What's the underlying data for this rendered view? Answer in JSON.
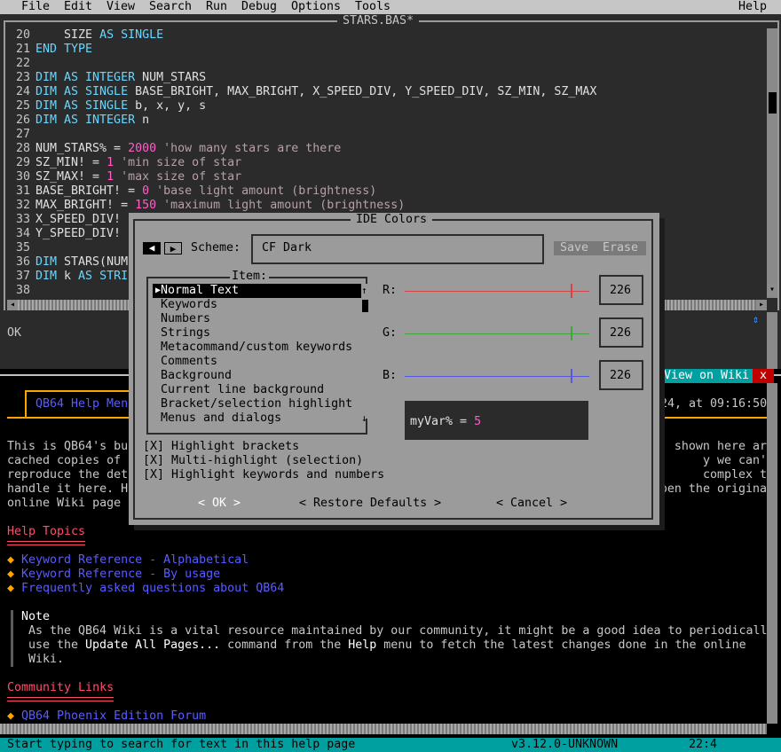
{
  "menubar": {
    "items": [
      "File",
      "Edit",
      "View",
      "Search",
      "Run",
      "Debug",
      "Options",
      "Tools"
    ],
    "help": "Help"
  },
  "editor": {
    "title": "STARS.BAS*",
    "lines": [
      {
        "n": "20",
        "code": [
          {
            "t": "    SIZE ",
            "c": ""
          },
          {
            "t": "AS SINGLE",
            "c": "kw"
          }
        ]
      },
      {
        "n": "21",
        "code": [
          {
            "t": "END TYPE",
            "c": "kw"
          }
        ]
      },
      {
        "n": "22",
        "code": []
      },
      {
        "n": "23",
        "code": [
          {
            "t": "DIM AS INTEGER ",
            "c": "kw"
          },
          {
            "t": "NUM_STARS",
            "c": ""
          }
        ]
      },
      {
        "n": "24",
        "code": [
          {
            "t": "DIM AS SINGLE ",
            "c": "kw"
          },
          {
            "t": "BASE_BRIGHT, MAX_BRIGHT, X_SPEED_DIV, Y_SPEED_DIV, SZ_MIN, SZ_MAX",
            "c": ""
          }
        ]
      },
      {
        "n": "25",
        "code": [
          {
            "t": "DIM AS SINGLE ",
            "c": "kw"
          },
          {
            "t": "b, x, y, s",
            "c": ""
          }
        ]
      },
      {
        "n": "26",
        "code": [
          {
            "t": "DIM AS INTEGER ",
            "c": "kw"
          },
          {
            "t": "n",
            "c": ""
          }
        ]
      },
      {
        "n": "27",
        "code": []
      },
      {
        "n": "28",
        "code": [
          {
            "t": "NUM_STARS% = ",
            "c": ""
          },
          {
            "t": "2000",
            "c": "num"
          },
          {
            "t": " 'how many stars are there",
            "c": "cm"
          }
        ]
      },
      {
        "n": "29",
        "code": [
          {
            "t": "SZ_MIN! = ",
            "c": ""
          },
          {
            "t": "1",
            "c": "num"
          },
          {
            "t": " 'min size of star",
            "c": "cm"
          }
        ]
      },
      {
        "n": "30",
        "code": [
          {
            "t": "SZ_MAX! = ",
            "c": ""
          },
          {
            "t": "1",
            "c": "num"
          },
          {
            "t": " 'max size of star",
            "c": "cm"
          }
        ]
      },
      {
        "n": "31",
        "code": [
          {
            "t": "BASE_BRIGHT! = ",
            "c": ""
          },
          {
            "t": "0",
            "c": "num"
          },
          {
            "t": " 'base light amount (brightness)",
            "c": "cm"
          }
        ]
      },
      {
        "n": "32",
        "code": [
          {
            "t": "MAX_BRIGHT! = ",
            "c": ""
          },
          {
            "t": "150",
            "c": "num"
          },
          {
            "t": " 'maximum light amount (brightness)",
            "c": "cm"
          }
        ]
      },
      {
        "n": "33",
        "code": [
          {
            "t": "X_SPEED_DIV!",
            "c": ""
          }
        ]
      },
      {
        "n": "34",
        "code": [
          {
            "t": "Y_SPEED_DIV!",
            "c": ""
          }
        ]
      },
      {
        "n": "35",
        "code": []
      },
      {
        "n": "36",
        "code": [
          {
            "t": "DIM ",
            "c": "kw"
          },
          {
            "t": "STARS(NUM",
            "c": ""
          }
        ]
      },
      {
        "n": "37",
        "code": [
          {
            "t": "DIM ",
            "c": "kw"
          },
          {
            "t": "k ",
            "c": ""
          },
          {
            "t": "AS STRI",
            "c": "kw"
          }
        ]
      },
      {
        "n": "38",
        "code": []
      }
    ]
  },
  "immediate": {
    "text": "OK"
  },
  "help": {
    "title_tab": "QB64 Help Men",
    "date_fragment": "24, at 09:16:50",
    "view_on_wiki": "View on Wiki",
    "close": "x",
    "para_lines": [
      {
        "l": "This is QB64's bu",
        "r": " shown here are"
      },
      {
        "l": "cached copies of ",
        "r": "y we can't"
      },
      {
        "l": "reproduce the det",
        "r": "complex to"
      },
      {
        "l": "handle it here. H",
        "r": "pen the original"
      },
      {
        "l": "online Wiki page ",
        "r": ""
      }
    ],
    "help_topics_heading": "Help Topics",
    "topics": [
      "Keyword Reference - Alphabetical",
      "Keyword Reference - By usage",
      "Frequently asked questions about QB64"
    ],
    "note_heading": "Note",
    "note_line1": "As the QB64 Wiki is a vital resource maintained by our community, it might be a good idea to periodically",
    "note_line2_a": "use the ",
    "note_line2_b": "Update All Pages...",
    "note_line2_c": " command from the ",
    "note_line2_d": "Help",
    "note_line2_e": " menu to fetch the latest changes done in the online",
    "note_line3": "Wiki.",
    "community_heading": "Community Links",
    "community_links": [
      "QB64 Phoenix Edition Forum"
    ]
  },
  "statusbar": {
    "message": "Start typing to search for text in this help page",
    "version": "v3.12.0-UNKNOWN",
    "position": "22:4"
  },
  "dialog": {
    "title": "IDE Colors",
    "scheme_label": "Scheme:",
    "scheme_value": "CF Dark",
    "save": "Save",
    "erase": "Erase",
    "item_label": "Item:",
    "items": [
      "Normal Text",
      "Keywords",
      "Numbers",
      "Strings",
      "Metacommand/custom keywords",
      "Comments",
      "Background",
      "Current line background",
      "Bracket/selection highlight",
      "Menus and dialogs"
    ],
    "selected_item": "Normal Text",
    "r_label": "R:",
    "g_label": "G:",
    "b_label": "B:",
    "r_value": "226",
    "g_value": "226",
    "b_value": "226",
    "preview_var": "myVar% = ",
    "preview_num": "5",
    "checks": [
      "[X] Highlight brackets",
      "[X] Multi-highlight (selection)",
      "[X] Highlight keywords and numbers"
    ],
    "ok": "< OK >",
    "restore": "< Restore Defaults >",
    "cancel": "< Cancel >",
    "colors": {
      "r": "#d64545",
      "g": "#3fa73f",
      "b": "#5858e0"
    }
  }
}
